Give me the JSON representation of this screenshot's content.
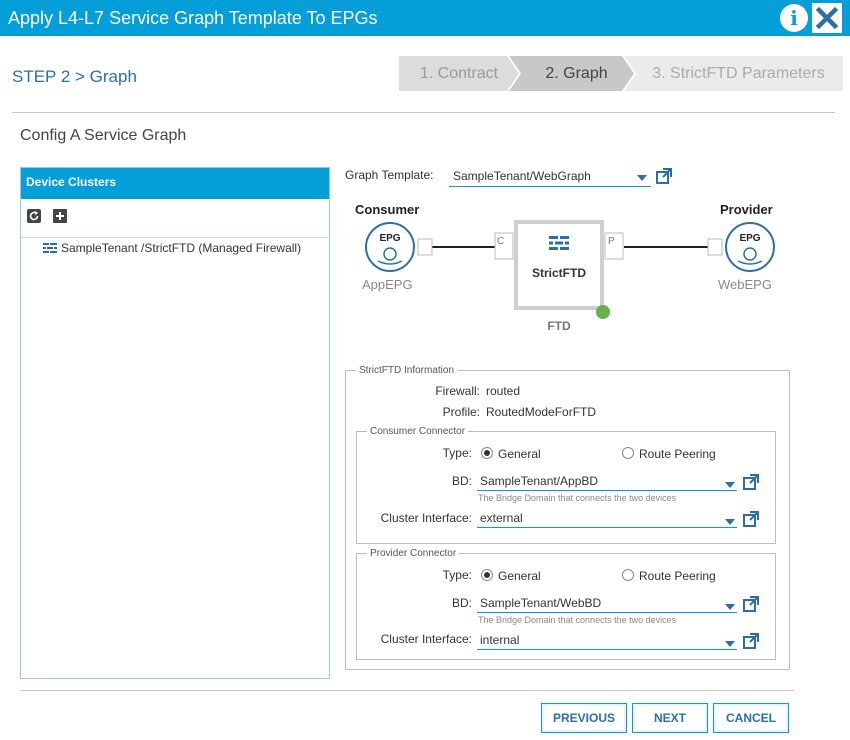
{
  "window": {
    "title": "Apply L4-L7 Service Graph Template To EPGs",
    "info_glyph": "i"
  },
  "step_title": "STEP 2 > Graph",
  "wizard": {
    "steps": [
      {
        "label": "1. Contract",
        "state": "done"
      },
      {
        "label": "2. Graph",
        "state": "active"
      },
      {
        "label": "3. StrictFTD Parameters",
        "state": "pending"
      }
    ]
  },
  "config_title": "Config A Service Graph",
  "device_clusters": {
    "header": "Device Clusters",
    "items": [
      {
        "label": "SampleTenant /StrictFTD (Managed Firewall)"
      }
    ]
  },
  "graph_template": {
    "label": "Graph Template:",
    "value": "SampleTenant/WebGraph"
  },
  "graph": {
    "consumer_label": "Consumer",
    "provider_label": "Provider",
    "consumer_epg": {
      "badge": "EPG",
      "name": "AppEPG"
    },
    "provider_epg": {
      "badge": "EPG",
      "name": "WebEPG"
    },
    "node": {
      "box_label": "StrictFTD",
      "name": "FTD",
      "status_color": "#6ab04c"
    },
    "port_c": "C",
    "port_p": "P"
  },
  "info": {
    "legend": "StrictFTD Information",
    "firewall_label": "Firewall:",
    "firewall_value": "routed",
    "profile_label": "Profile:",
    "profile_value": "RoutedModeForFTD",
    "consumer_connector": {
      "legend": "Consumer Connector",
      "type_label": "Type:",
      "type_options": [
        "General",
        "Route Peering"
      ],
      "type_selected": "General",
      "bd_label": "BD:",
      "bd_value": "SampleTenant/AppBD",
      "bd_hint": "The Bridge Domain that connects the two devices",
      "ci_label": "Cluster Interface:",
      "ci_value": "external"
    },
    "provider_connector": {
      "legend": "Provider Connector",
      "type_label": "Type:",
      "type_options": [
        "General",
        "Route Peering"
      ],
      "type_selected": "General",
      "bd_label": "BD:",
      "bd_value": "SampleTenant/WebBD",
      "bd_hint": "The Bridge Domain that connects the two devices",
      "ci_label": "Cluster Interface:",
      "ci_value": "internal"
    }
  },
  "buttons": {
    "previous": "PREVIOUS",
    "next": "NEXT",
    "cancel": "CANCEL"
  },
  "colors": {
    "accent": "#049fd9",
    "link": "#2a6fa8",
    "wizard_done": "#dcdcdc",
    "wizard_active": "#c8c8c8",
    "wizard_pending": "#ebebeb"
  },
  "icons": [
    "info-icon",
    "close-icon",
    "refresh-icon",
    "plus-icon",
    "firewall-icon",
    "external-link-icon",
    "epg-icon"
  ]
}
